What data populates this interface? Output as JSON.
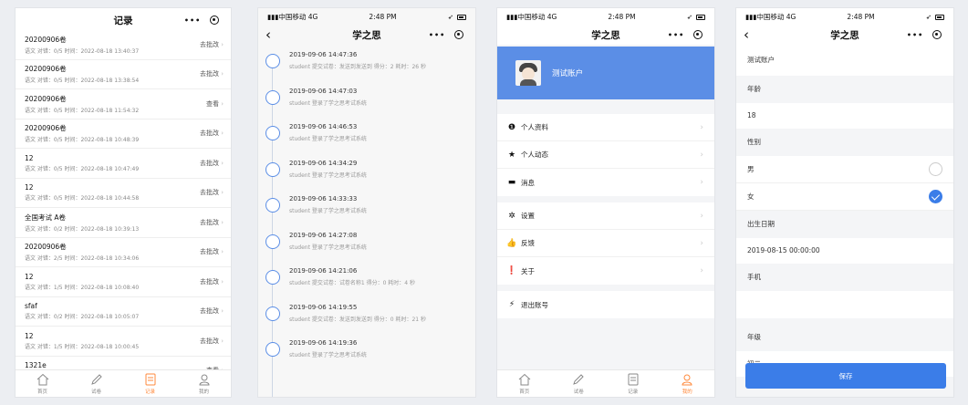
{
  "records_screen": {
    "title": "记录",
    "items": [
      {
        "name": "20200906卷",
        "meta": "语文 对错：0/5 时间：2022-08-18 13:40:37",
        "action": "去批改"
      },
      {
        "name": "20200906卷",
        "meta": "语文 对错：0/5 时间：2022-08-18 13:38:54",
        "action": "去批改"
      },
      {
        "name": "20200906卷",
        "meta": "语文 对错：0/5 时间：2022-08-18 11:54:32",
        "action": "查看"
      },
      {
        "name": "20200906卷",
        "meta": "语文 对错：0/5 时间：2022-08-18 10:48:39",
        "action": "去批改"
      },
      {
        "name": "12",
        "meta": "语文 对错：0/5 时间：2022-08-18 10:47:49",
        "action": "去批改"
      },
      {
        "name": "12",
        "meta": "语文 对错：0/5 时间：2022-08-18 10:44:58",
        "action": "去批改"
      },
      {
        "name": "全国考试 A卷",
        "meta": "语文 对错：0/2 时间：2022-08-18 10:39:13",
        "action": "去批改"
      },
      {
        "name": "20200906卷",
        "meta": "语文 对错：2/5 时间：2022-08-18 10:34:06",
        "action": "去批改"
      },
      {
        "name": "12",
        "meta": "语文 对错：1/5 时间：2022-08-18 10:08:40",
        "action": "去批改"
      },
      {
        "name": "sfaf",
        "meta": "语文 对错：0/2 时间：2022-08-18 10:05:07",
        "action": "去批改"
      },
      {
        "name": "12",
        "meta": "语文 对错：1/5 时间：2022-08-18 10:00:45",
        "action": "去批改"
      },
      {
        "name": "1321e",
        "meta": "语文 对错：0/1 时间：2022-08-18 09:46:15",
        "action": "查看"
      }
    ]
  },
  "tabbar": {
    "home": "首页",
    "exam": "试卷",
    "records": "记录",
    "mine": "我的"
  },
  "status": {
    "carrier": "中国移动",
    "network": "4G",
    "time": "2:48 PM"
  },
  "app_title": "学之思",
  "timeline_screen": {
    "items": [
      {
        "time": "2019-09-06 14:47:36",
        "desc": "student 提交试卷：发送到发送到 得分：2 耗时：26 秒"
      },
      {
        "time": "2019-09-06 14:47:03",
        "desc": "student 登录了学之思考试系统"
      },
      {
        "time": "2019-09-06 14:46:53",
        "desc": "student 登录了学之思考试系统"
      },
      {
        "time": "2019-09-06 14:34:29",
        "desc": "student 登录了学之思考试系统"
      },
      {
        "time": "2019-09-06 14:33:33",
        "desc": "student 登录了学之思考试系统"
      },
      {
        "time": "2019-09-06 14:27:08",
        "desc": "student 登录了学之思考试系统"
      },
      {
        "time": "2019-09-06 14:21:06",
        "desc": "student 提交试卷：试卷名称1 得分：0 耗时：4 秒"
      },
      {
        "time": "2019-09-06 14:19:55",
        "desc": "student 提交试卷：发送到发送到 得分：0 耗时：21 秒"
      },
      {
        "time": "2019-09-06 14:19:36",
        "desc": "student 登录了学之思考试系统"
      }
    ]
  },
  "profile_screen": {
    "user_name": "测试账户",
    "menu1": [
      {
        "icon": "info-icon",
        "label": "个人资料"
      },
      {
        "icon": "star-icon",
        "label": "个人动态"
      },
      {
        "icon": "message-icon",
        "label": "消息"
      }
    ],
    "menu2": [
      {
        "icon": "gear-icon",
        "label": "设置"
      },
      {
        "icon": "thumbs-up-icon",
        "label": "反馈"
      },
      {
        "icon": "about-icon",
        "label": "关于"
      }
    ],
    "logout": {
      "icon": "bolt-icon",
      "label": "退出账号"
    }
  },
  "edit_screen": {
    "name_value": "测试账户",
    "age_label": "年龄",
    "age_value": "18",
    "gender_label": "性别",
    "gender_male": "男",
    "gender_female": "女",
    "gender_selected": "女",
    "birth_label": "出生日期",
    "birth_value": "2019-08-15 00:00:00",
    "phone_label": "手机",
    "phone_value": "",
    "grade_label": "年级",
    "grade_value": "初二",
    "save_label": "保存"
  },
  "colors": {
    "accent": "#3b7de8",
    "header_blue": "#5b8ee6",
    "tab_active": "#ff8a3d"
  }
}
